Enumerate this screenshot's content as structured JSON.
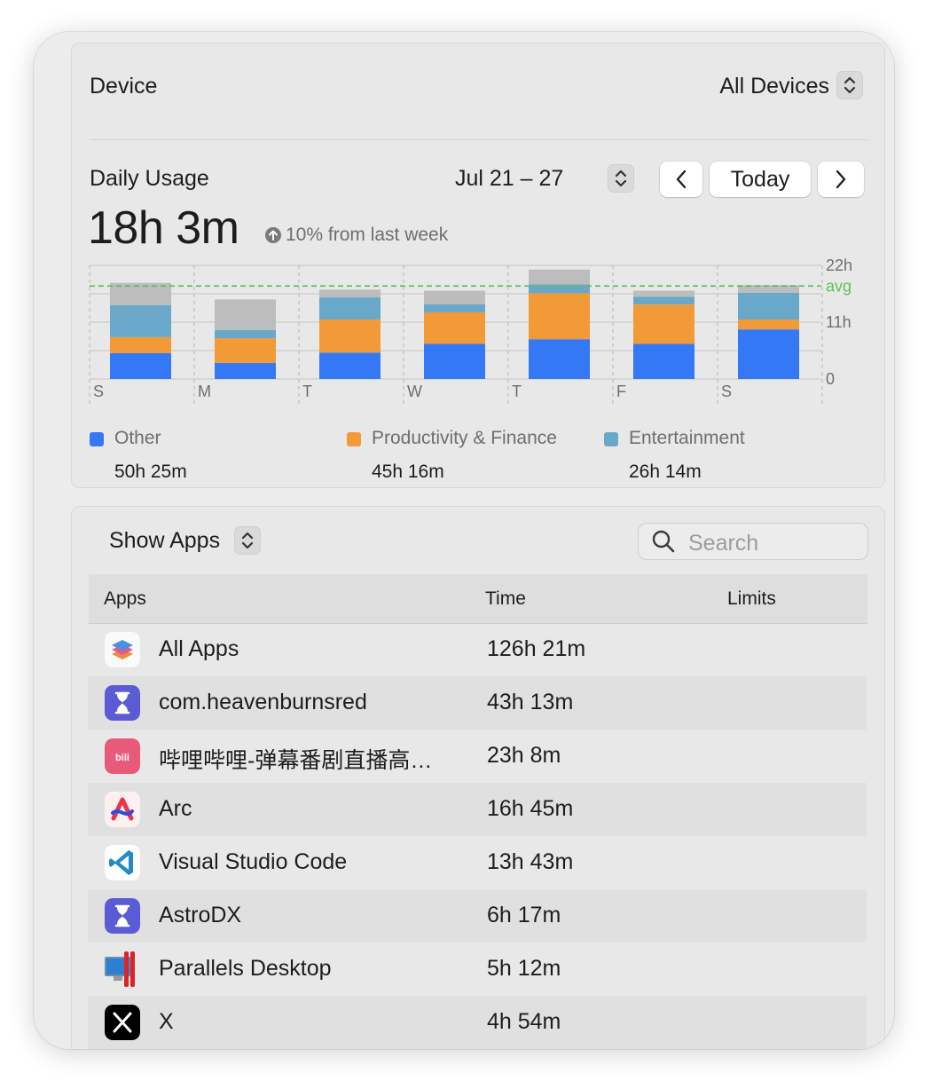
{
  "device": {
    "label": "Device",
    "selected": "All Devices"
  },
  "usage": {
    "label": "Daily Usage",
    "date_range": "Jul 21 – 27",
    "today_button": "Today",
    "total": "18h 3m",
    "change": "10% from last week"
  },
  "colors": {
    "other": "#3478f6",
    "productivity": "#f19a37",
    "entertainment": "#69a8c9",
    "remainder": "#bdbdbd",
    "avg_line": "#5cc15c"
  },
  "chart_data": {
    "type": "bar",
    "stacked": true,
    "categories": [
      "S",
      "M",
      "T",
      "W",
      "T",
      "F",
      "S"
    ],
    "series": [
      {
        "name": "Other",
        "values": [
          5.0,
          3.1,
          5.1,
          6.8,
          7.7,
          6.8,
          9.6
        ]
      },
      {
        "name": "Productivity & Finance",
        "values": [
          3.1,
          4.8,
          6.4,
          6.1,
          8.9,
          7.6,
          1.9
        ]
      },
      {
        "name": "Entertainment",
        "values": [
          6.2,
          1.6,
          4.3,
          1.6,
          1.7,
          1.5,
          5.2
        ]
      },
      {
        "name": "",
        "values": [
          4.3,
          5.9,
          1.5,
          2.6,
          2.9,
          1.2,
          1.5
        ]
      }
    ],
    "y_ticks": [
      "22h",
      "11h",
      "0"
    ],
    "ylim": [
      0,
      22
    ],
    "avg_label": "avg",
    "avg_value": 18.0,
    "grid": true,
    "legend_position": "bottom"
  },
  "legend": [
    {
      "label": "Other",
      "total": "50h 25m"
    },
    {
      "label": "Productivity & Finance",
      "total": "45h 16m"
    },
    {
      "label": "Entertainment",
      "total": "26h 14m"
    }
  ],
  "apps_panel": {
    "show_label": "Show Apps",
    "search_placeholder": "Search",
    "columns": [
      "Apps",
      "Time",
      "Limits"
    ],
    "rows": [
      {
        "name": "All Apps",
        "time": "126h 21m",
        "icon": "all-apps-icon"
      },
      {
        "name": "com.heavenburnsred",
        "time": "43h 13m",
        "icon": "hourglass-icon"
      },
      {
        "name": "哔哩哔哩-弹幕番剧直播高…",
        "time": "23h 8m",
        "icon": "bilibili-icon"
      },
      {
        "name": "Arc",
        "time": "16h 45m",
        "icon": "arc-icon"
      },
      {
        "name": "Visual Studio Code",
        "time": "13h 43m",
        "icon": "vscode-icon"
      },
      {
        "name": "AstroDX",
        "time": "6h 17m",
        "icon": "hourglass-icon"
      },
      {
        "name": "Parallels Desktop",
        "time": "5h 12m",
        "icon": "parallels-icon"
      },
      {
        "name": "X",
        "time": "4h 54m",
        "icon": "x-icon"
      }
    ]
  }
}
